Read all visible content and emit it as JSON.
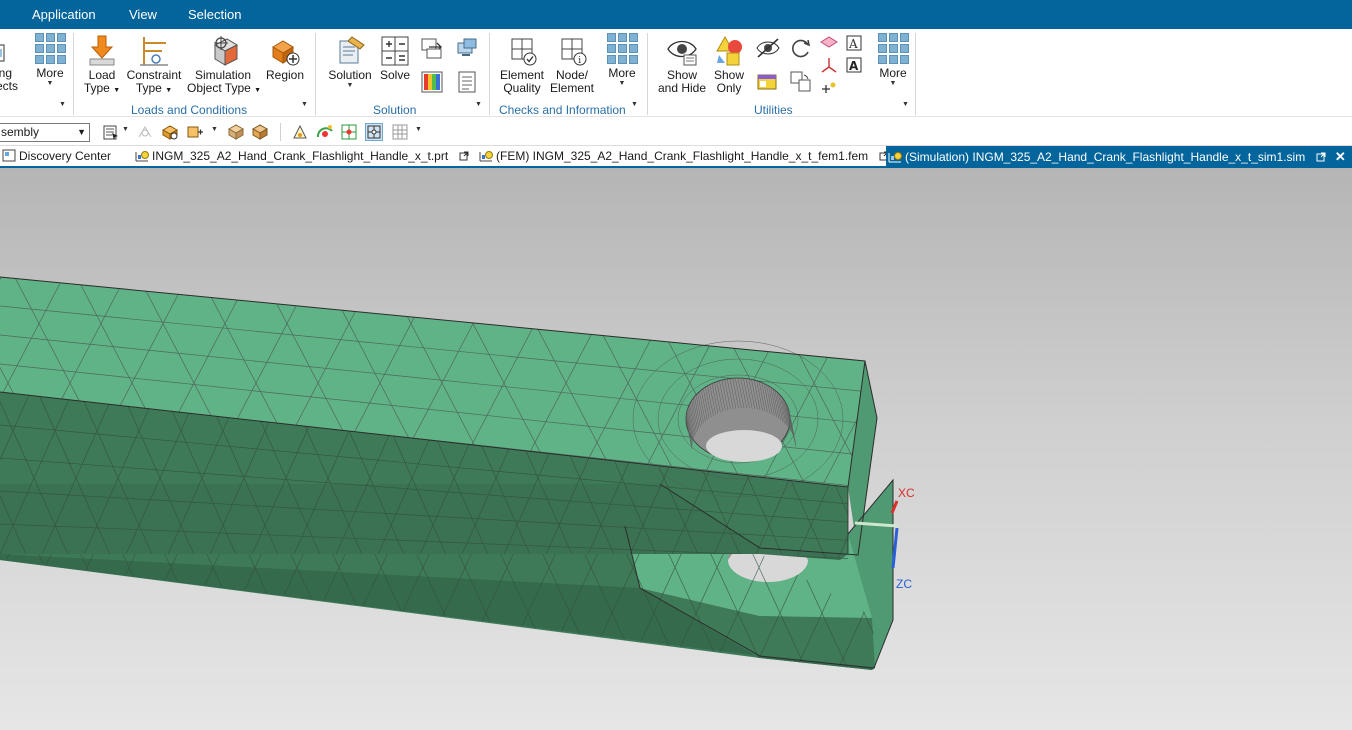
{
  "menu": {
    "items": [
      "Application",
      "View",
      "Selection"
    ]
  },
  "ribbon": {
    "left_cut": {
      "label1": "ing",
      "label2": "ects"
    },
    "more1": "More",
    "load_type": {
      "l1": "Load",
      "l2": "Type"
    },
    "constraint_type": {
      "l1": "Constraint",
      "l2": "Type"
    },
    "simulation_object_type": {
      "l1": "Simulation",
      "l2": "Object Type"
    },
    "region": "Region",
    "loads_group": "Loads and Conditions",
    "solution": "Solution",
    "solve": "Solve",
    "solution_group": "Solution",
    "element_quality": {
      "l1": "Element",
      "l2": "Quality"
    },
    "node_element": {
      "l1": "Node/",
      "l2": "Element"
    },
    "more2": "More",
    "checks_group": "Checks and Information",
    "show_and_hide": {
      "l1": "Show",
      "l2": "and Hide"
    },
    "show_only": {
      "l1": "Show",
      "l2": "Only"
    },
    "more3": "More",
    "utilities_group": "Utilities"
  },
  "selection_bar": {
    "filter_value": "sembly"
  },
  "tabs": [
    {
      "label": "Discovery Center"
    },
    {
      "label": "INGM_325_A2_Hand_Crank_Flashlight_Handle_x_t.prt"
    },
    {
      "label": "(FEM) INGM_325_A2_Hand_Crank_Flashlight_Handle_x_t_fem1.fem"
    },
    {
      "label": "(Simulation) INGM_325_A2_Hand_Crank_Flashlight_Handle_x_t_sim1.sim",
      "close": "✕"
    }
  ],
  "viewport": {
    "axes": {
      "x": "XC",
      "z": "ZC"
    }
  },
  "colors": {
    "menubar": "#03659b",
    "mesh_top": "#5fb386",
    "mesh_side": "#3e7a58",
    "mesh_lines": "#4d5b54",
    "accent": "#2a6fa8"
  }
}
